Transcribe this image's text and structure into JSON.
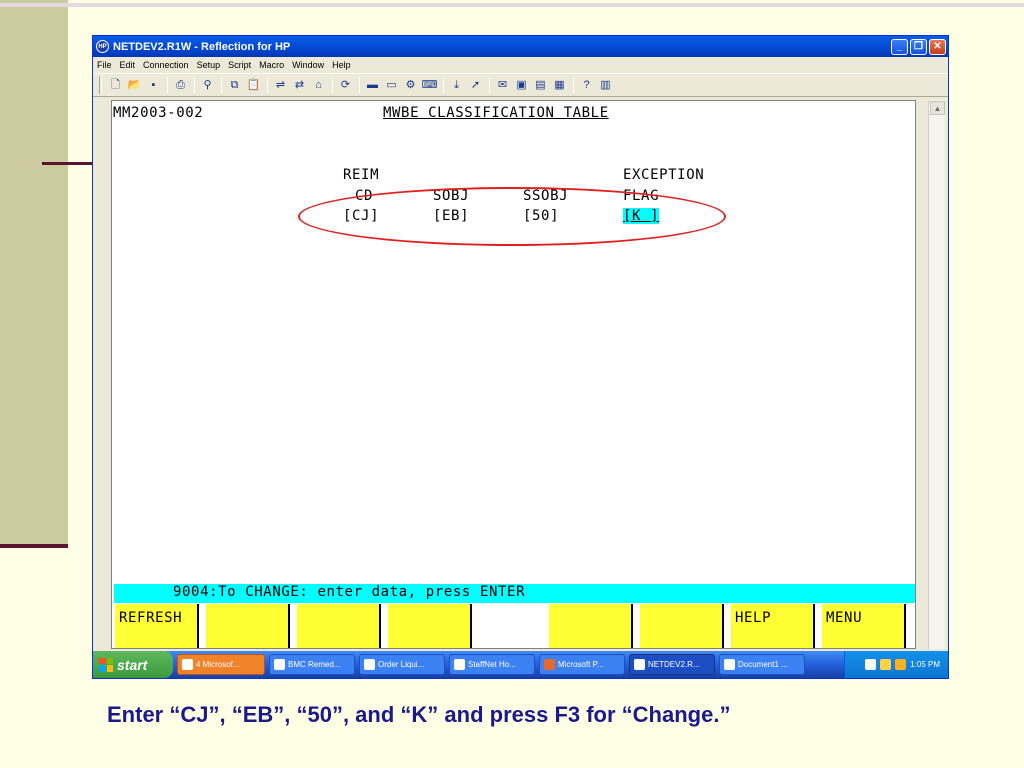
{
  "window": {
    "title": "NETDEV2.R1W - Reflection for HP",
    "icon_label": "HP"
  },
  "menu": [
    "File",
    "Edit",
    "Connection",
    "Setup",
    "Script",
    "Macro",
    "Window",
    "Help"
  ],
  "toolbar_icons": [
    "new-icon",
    "open-icon",
    "save-icon",
    "print-icon",
    "find-icon",
    "copy-icon",
    "paste-icon",
    "connect-icon",
    "transfer-icon",
    "host-icon",
    "macro-icon",
    "terminal-icon",
    "display-icon",
    "settings-icon",
    "keyboard-icon",
    "download-icon",
    "pointer-icon",
    "mail-icon",
    "window-icon",
    "layout-icon",
    "grid-icon",
    "help-icon",
    "book-icon"
  ],
  "screen": {
    "screen_id": "MM2003-002",
    "screen_title": "MWBE CLASSIFICATION TABLE",
    "headers": {
      "reim_line1": "REIM",
      "reim_line2": "CD",
      "sobj": "SOBJ",
      "ssobj": "SSOBJ",
      "exception_line1": "EXCEPTION",
      "exception_line2": "FLAG"
    },
    "fields": {
      "reim_cd": "[CJ]",
      "sobj": "[EB]",
      "ssobj": "[50]",
      "exception_flag": "[K ]"
    },
    "status_message": "9004:To CHANGE: enter data, press ENTER",
    "function_keys": [
      "REFRESH",
      "",
      "",
      "",
      "",
      "",
      "",
      "HELP",
      "MENU"
    ]
  },
  "taskbar": {
    "start_label": "start",
    "items": [
      "4 Microsof...",
      "BMC Remed...",
      "Order Liqui...",
      "StaffNet Ho...",
      "Microsoft P...",
      "NETDEV2.R...",
      "Document1 ..."
    ],
    "clock": "1:05 PM"
  },
  "caption": "Enter “CJ”, “EB”, “50”, and “K” and press F3 for “Change.”"
}
